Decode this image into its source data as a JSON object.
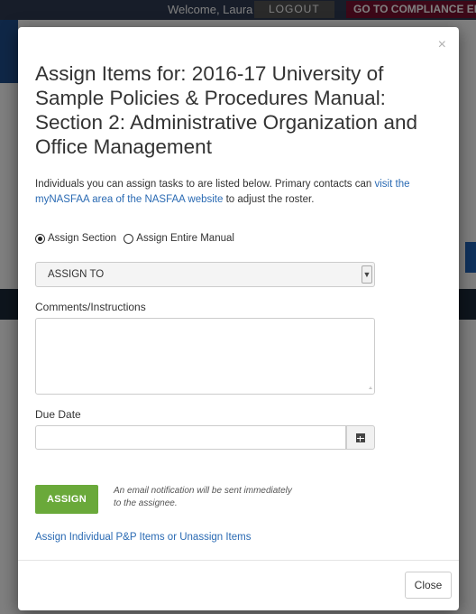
{
  "background": {
    "welcome": "Welcome, Laura",
    "logout": "LOGOUT",
    "compliance": "GO TO COMPLIANCE EN"
  },
  "modal": {
    "close_glyph": "×",
    "title": "Assign Items for: 2016-17 University of Sample Policies & Procedures Manual: Section 2: Administrative Organization and Office Management",
    "intro_text": "Individuals you can assign tasks to are listed below. Primary contacts can ",
    "intro_link": "visit the myNASFAA area of the NASFAA website",
    "intro_suffix": " to adjust the roster.",
    "radio_section": "Assign Section",
    "radio_manual": "Assign Entire Manual",
    "select_value": "ASSIGN TO",
    "comments_label": "Comments/Instructions",
    "due_date_label": "Due Date",
    "due_date_value": "",
    "assign_button": "ASSIGN",
    "assign_note": "An email notification will be sent immediately to the assignee.",
    "individual_link": "Assign Individual P&P Items or Unassign Items",
    "close_button": "Close"
  },
  "icons": {
    "select_arrow": "chevron-down-icon",
    "calendar": "calendar-icon"
  },
  "colors": {
    "accent_green": "#6aa93a",
    "link_blue": "#2a6ab3"
  }
}
